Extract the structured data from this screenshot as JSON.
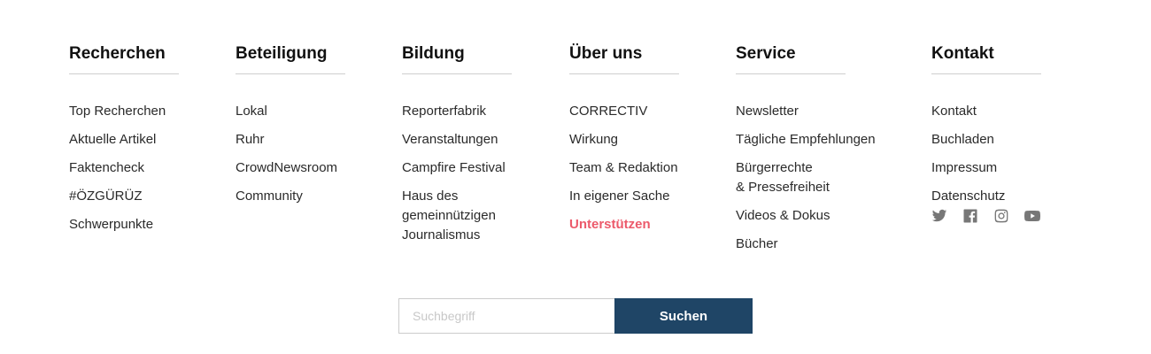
{
  "columns": [
    {
      "title": "Recherchen",
      "links": [
        "Top Recherchen",
        "Aktuelle Artikel",
        "Faktencheck",
        "#ÖZGÜRÜZ",
        "Schwerpunkte"
      ]
    },
    {
      "title": "Beteiligung",
      "links": [
        "Lokal",
        "Ruhr",
        "CrowdNewsroom",
        "Community"
      ]
    },
    {
      "title": "Bildung",
      "links": [
        "Reporterfabrik",
        "Veranstaltungen",
        "Campfire Festival",
        "Haus des\ngemeinnützigen\nJournalismus"
      ]
    },
    {
      "title": "Über uns",
      "links": [
        "CORRECTIV",
        "Wirkung",
        "Team & Redaktion",
        "In eigener Sache",
        "Unterstützen"
      ]
    },
    {
      "title": "Service",
      "links": [
        "Newsletter",
        "Tägliche Empfehlungen",
        "Bürgerrechte\n& Pressefreiheit",
        "Videos & Dokus",
        "Bücher"
      ]
    },
    {
      "title": "Kontakt",
      "links": [
        "Kontakt",
        "Buchladen",
        "Impressum",
        "Datenschutz"
      ]
    }
  ],
  "social": [
    "twitter-icon",
    "facebook-icon",
    "instagram-icon",
    "youtube-icon"
  ],
  "search": {
    "placeholder": "Suchbegriff",
    "button_label": "Suchen"
  },
  "colors": {
    "highlight": "#ec5a6b",
    "button_bg": "#1f4566",
    "icon": "#777777"
  }
}
